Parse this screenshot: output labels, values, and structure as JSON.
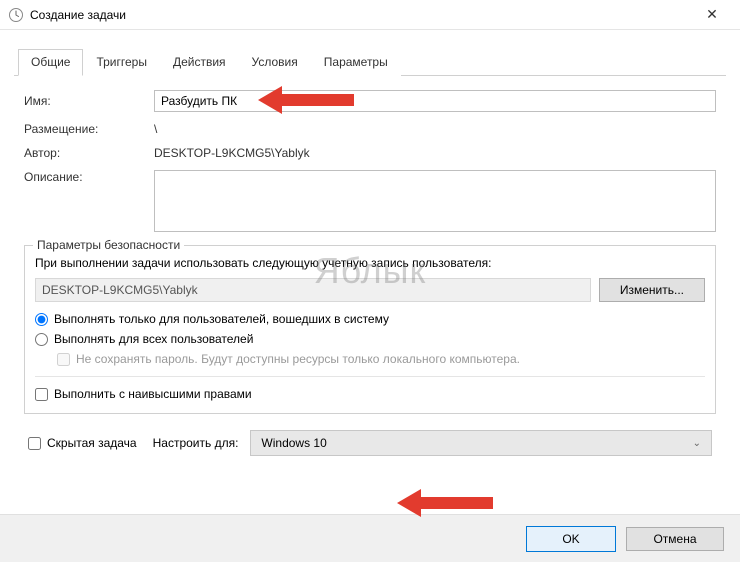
{
  "window": {
    "title": "Создание задачи",
    "close": "✕"
  },
  "tabs": {
    "general": "Общие",
    "triggers": "Триггеры",
    "actions": "Действия",
    "conditions": "Условия",
    "settings": "Параметры"
  },
  "general": {
    "name_label": "Имя:",
    "name_value": "Разбудить ПК",
    "location_label": "Размещение:",
    "location_value": "\\",
    "author_label": "Автор:",
    "author_value": "DESKTOP-L9KCMG5\\Yablyk",
    "description_label": "Описание:",
    "description_value": ""
  },
  "security": {
    "legend": "Параметры безопасности",
    "run_as_text": "При выполнении задачи использовать следующую учетную запись пользователя:",
    "account": "DESKTOP-L9KCMG5\\Yablyk",
    "change_btn": "Изменить...",
    "radio_logged_on": "Выполнять только для пользователей, вошедших в систему",
    "radio_any_user": "Выполнять для всех пользователей",
    "no_store_password": "Не сохранять пароль. Будут доступны ресурсы только локального компьютера.",
    "highest_priv": "Выполнить с наивысшими правами"
  },
  "bottom": {
    "hidden_task": "Скрытая задача",
    "configure_for": "Настроить для:",
    "configure_value": "Windows 10"
  },
  "footer": {
    "ok": "OK",
    "cancel": "Отмена"
  },
  "watermark": "Яблык"
}
